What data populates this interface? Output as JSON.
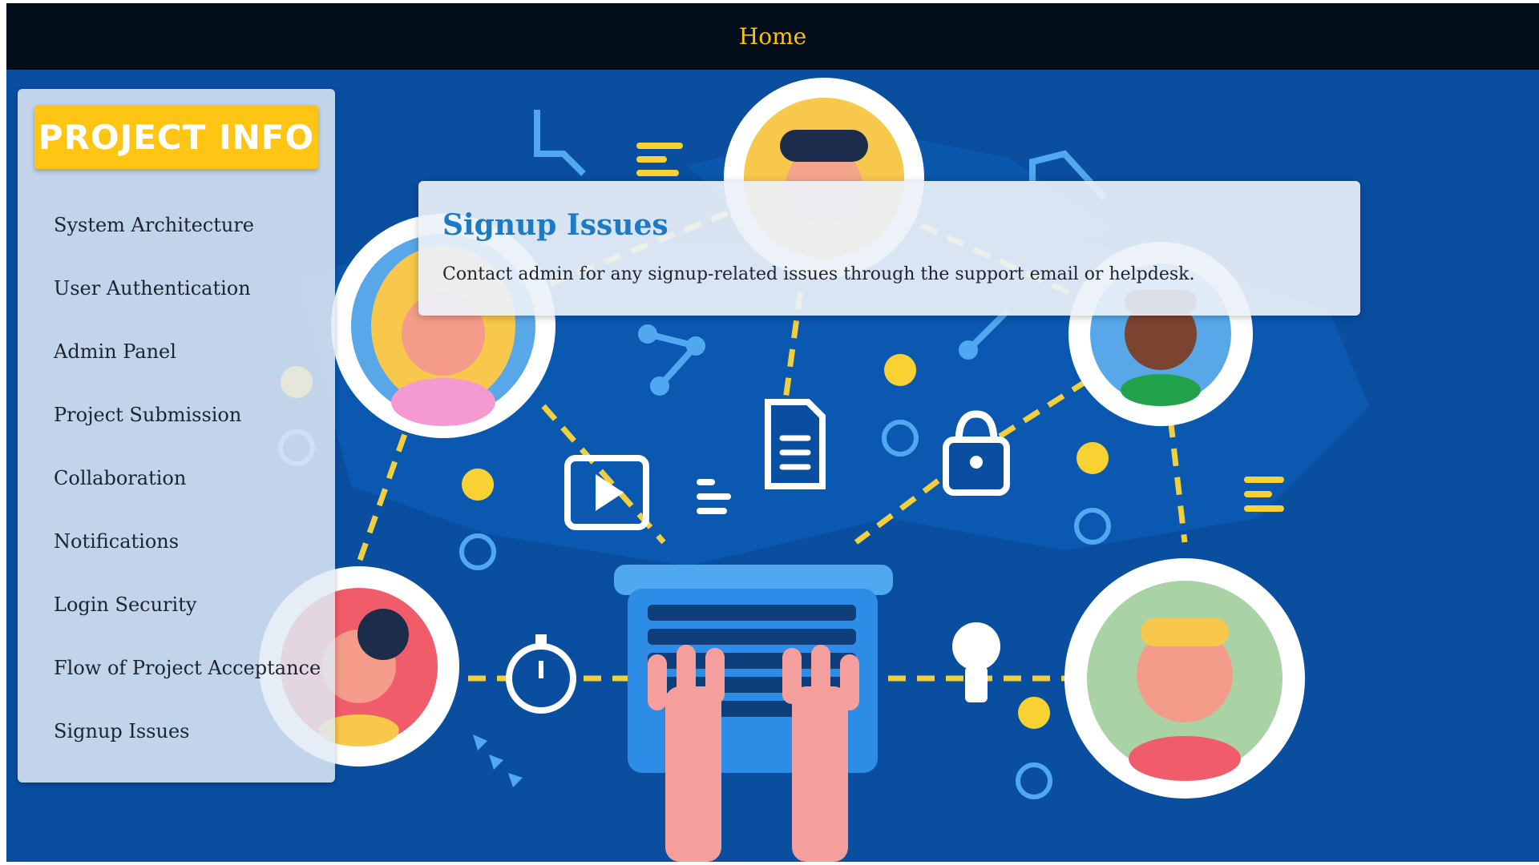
{
  "header": {
    "home_label": "Home"
  },
  "sidebar": {
    "brand": "PROJECT INFO",
    "items": [
      {
        "label": "System Architecture"
      },
      {
        "label": "User Authentication"
      },
      {
        "label": "Admin Panel"
      },
      {
        "label": "Project Submission"
      },
      {
        "label": "Collaboration"
      },
      {
        "label": "Notifications"
      },
      {
        "label": "Login Security"
      },
      {
        "label": "Flow of Project Acceptance"
      },
      {
        "label": "Signup Issues"
      }
    ]
  },
  "content": {
    "title": "Signup Issues",
    "body": "Contact admin for any signup-related issues through the support email or helpdesk."
  },
  "colors": {
    "header_bg": "#020d1a",
    "header_link": "#ffc107",
    "hero_bg": "#0a4ea0",
    "brand_bg": "#ffc515",
    "title_color": "#1e7ac3"
  }
}
